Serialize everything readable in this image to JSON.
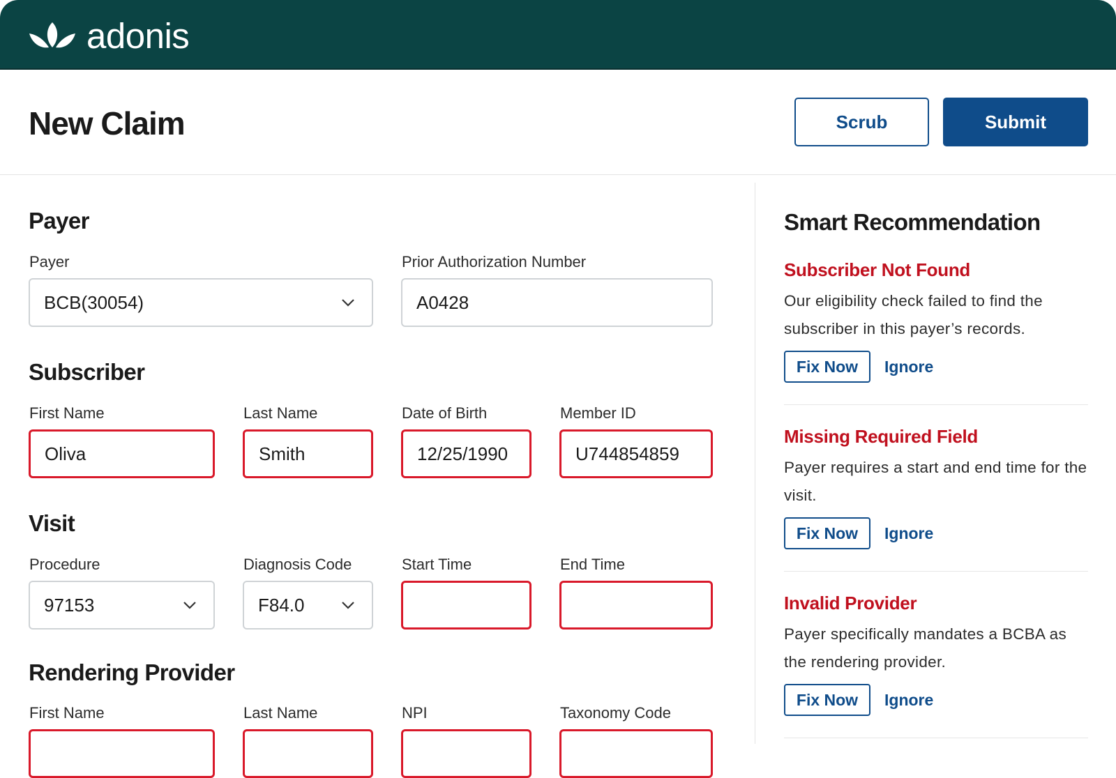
{
  "app": {
    "brand": "adonis",
    "brand_color": "#0b4444",
    "accent": "#0f4c8a",
    "error_color": "#d9192a"
  },
  "header": {
    "title": "New Claim",
    "scrub_label": "Scrub",
    "submit_label": "Submit"
  },
  "payer": {
    "section": "Payer",
    "payer_label": "Payer",
    "payer_value": "BCB(30054)",
    "prior_auth_label": "Prior Authorization Number",
    "prior_auth_value": "A0428"
  },
  "subscriber": {
    "section": "Subscriber",
    "first_name_label": "First Name",
    "first_name_value": "Oliva",
    "last_name_label": "Last Name",
    "last_name_value": "Smith",
    "dob_label": "Date of Birth",
    "dob_value": "12/25/1990",
    "member_id_label": "Member ID",
    "member_id_value": "U744854859"
  },
  "visit": {
    "section": "Visit",
    "procedure_label": "Procedure",
    "procedure_value": "97153",
    "diagnosis_label": "Diagnosis Code",
    "diagnosis_value": "F84.0",
    "start_label": "Start Time",
    "start_value": "",
    "end_label": "End Time",
    "end_value": ""
  },
  "provider": {
    "section": "Rendering Provider",
    "first_name_label": "First Name",
    "last_name_label": "Last Name",
    "npi_label": "NPI",
    "taxonomy_label": "Taxonomy Code"
  },
  "recommendations": {
    "title": "Smart Recommendation",
    "items": [
      {
        "title": "Subscriber Not Found",
        "body": "Our eligibility check failed to find the subscriber in this payer’s records.",
        "fix": "Fix Now",
        "ignore": "Ignore"
      },
      {
        "title": "Missing Required Field",
        "body": "Payer requires a start and end time for the visit.",
        "fix": "Fix Now",
        "ignore": "Ignore"
      },
      {
        "title": "Invalid Provider",
        "body": "Payer specifically mandates a BCBA as the rendering provider.",
        "fix": "Fix Now",
        "ignore": "Ignore"
      }
    ]
  }
}
